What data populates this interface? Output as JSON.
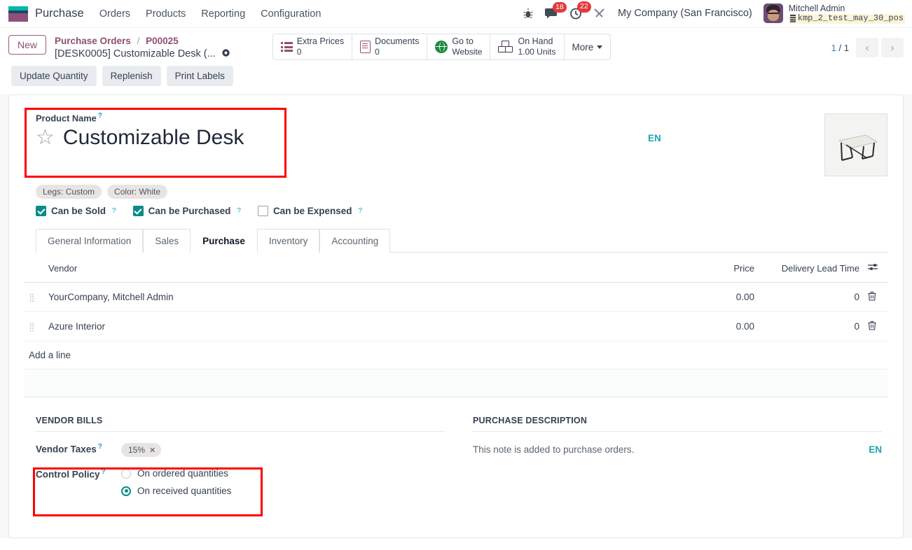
{
  "navbar": {
    "app_name": "Purchase",
    "menu": [
      {
        "label": "Orders"
      },
      {
        "label": "Products"
      },
      {
        "label": "Reporting"
      },
      {
        "label": "Configuration"
      }
    ],
    "icons": {
      "debug": "bug-icon",
      "messages": "chat-icon",
      "activities": "clock-icon",
      "tools": "tools-icon"
    },
    "messages_count": "18",
    "activities_count": "22",
    "company": "My Company (San Francisco)",
    "user_name": "Mitchell Admin",
    "user_database": "kmp_2_test_may_30_pos"
  },
  "control_panel": {
    "new_label": "New",
    "breadcrumb_root": "Purchase Orders",
    "breadcrumb_sep": "/",
    "breadcrumb_order": "P00025",
    "breadcrumb_record": "[DESK0005] Customizable Desk (...",
    "stats": [
      {
        "name": "extra-prices",
        "icon": "list-icon",
        "label": "Extra Prices",
        "value": "0"
      },
      {
        "name": "documents",
        "icon": "document-icon",
        "label": "Documents",
        "value": "0"
      },
      {
        "name": "go-to-website",
        "icon": "globe-icon",
        "label": "Go to",
        "value": "Website"
      },
      {
        "name": "on-hand",
        "icon": "boxes-icon",
        "label": "On Hand",
        "value": "1.00 Units"
      }
    ],
    "more_label": "More",
    "pager_current": "1",
    "pager_sep": "/",
    "pager_total": "1"
  },
  "action_buttons": [
    {
      "label": "Update Quantity"
    },
    {
      "label": "Replenish"
    },
    {
      "label": "Print Labels"
    }
  ],
  "product": {
    "name_label": "Product Name",
    "name": "Customizable Desk",
    "lang_badge": "EN",
    "tags": [
      "Legs: Custom",
      "Color: White"
    ],
    "checkboxes": [
      {
        "label": "Can be Sold",
        "checked": true
      },
      {
        "label": "Can be Purchased",
        "checked": true
      },
      {
        "label": "Can be Expensed",
        "checked": false
      }
    ]
  },
  "tabs": [
    {
      "label": "General Information",
      "active": false
    },
    {
      "label": "Sales",
      "active": false
    },
    {
      "label": "Purchase",
      "active": true
    },
    {
      "label": "Inventory",
      "active": false
    },
    {
      "label": "Accounting",
      "active": false
    }
  ],
  "vendor_table": {
    "columns": [
      "Vendor",
      "Price",
      "Delivery Lead Time"
    ],
    "rows": [
      {
        "vendor": "YourCompany, Mitchell Admin",
        "price": "0.00",
        "lead_time": "0"
      },
      {
        "vendor": "Azure Interior",
        "price": "0.00",
        "lead_time": "0"
      }
    ],
    "add_line_label": "Add a line"
  },
  "vendor_bills": {
    "title": "VENDOR BILLS",
    "vendor_taxes_label": "Vendor Taxes",
    "vendor_tax_value": "15%",
    "control_policy_label": "Control Policy",
    "control_policy_options": [
      {
        "label": "On ordered quantities",
        "selected": false
      },
      {
        "label": "On received quantities",
        "selected": true
      }
    ]
  },
  "purchase_description": {
    "title": "PURCHASE DESCRIPTION",
    "note": "This note is added to purchase orders.",
    "lang_badge": "EN"
  },
  "colors": {
    "brand_purple": "#8f4f6f",
    "brand_teal": "#00b8ac",
    "accent_cyan": "#1fa3b5",
    "checkbox_teal": "#0d8a8a",
    "highlight_red": "#ff0000",
    "badge_red": "#e3393c"
  }
}
